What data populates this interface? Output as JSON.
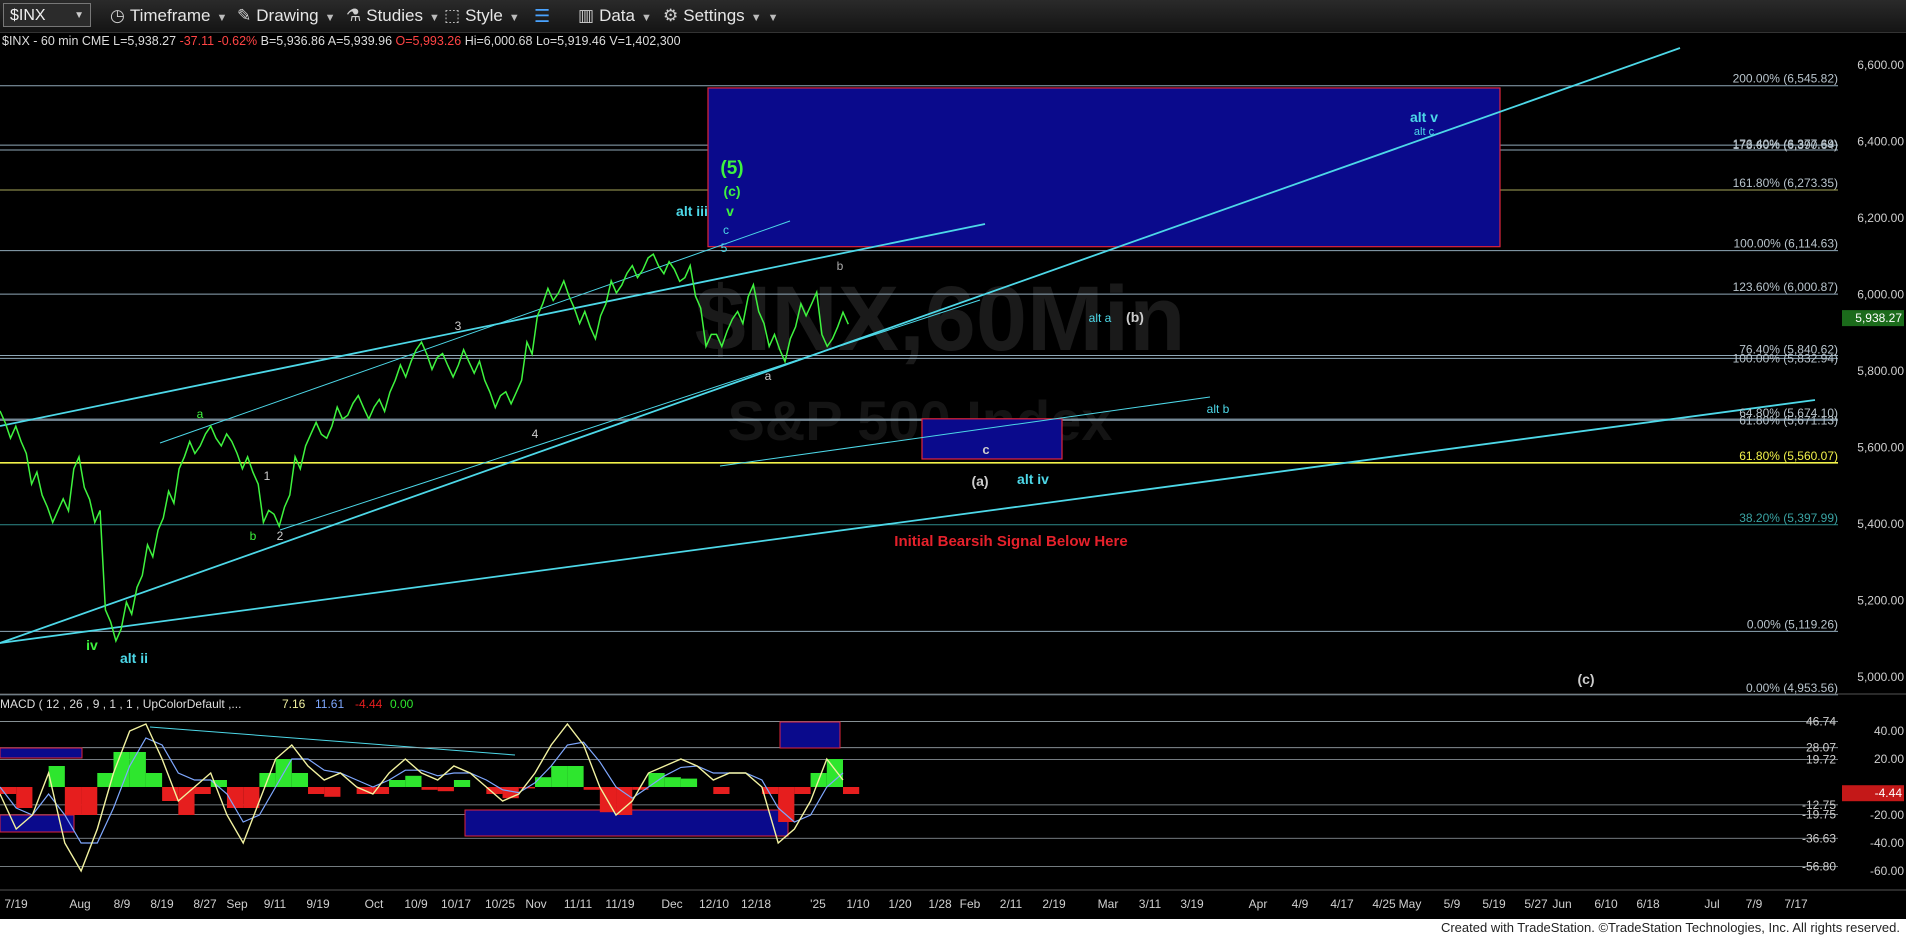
{
  "toolbar": {
    "symbol": "$INX",
    "timeframe": "Timeframe",
    "drawing": "Drawing",
    "studies": "Studies",
    "style": "Style",
    "data": "Data",
    "settings": "Settings"
  },
  "infobar": {
    "symbol": "$INX - 60 min  CME",
    "last": "L=5,938.27",
    "change": "-37.11",
    "pct": "-0.62%",
    "bid": "B=5,936.86",
    "ask": "A=5,939.96",
    "open": "O=5,993.26",
    "high": "Hi=6,000.68",
    "low": "Lo=5,919.46",
    "volume": "V=1,402,300"
  },
  "watermark": {
    "line1": "$INX,60Min",
    "line2": "S&P 500 Index"
  },
  "colors": {
    "price": "#3ef33e",
    "trend": "#4dd8e8",
    "box": "#0a0a8c",
    "box_border": "#e0243c",
    "fib_line": "#8fa8b8",
    "fib_yellow": "#f2f24a",
    "bearish": "#e5212b",
    "macd_line": "#f2f2a0",
    "signal_line": "#7fa8ff",
    "hist_pos": "#2ee62e",
    "hist_neg": "#e61e1e"
  },
  "chart_data": [
    {
      "type": "line",
      "title": "$INX - 60 min",
      "ylim": [
        4950,
        6700
      ],
      "y_ticks": [
        "6,600.00",
        "6,400.00",
        "6,200.00",
        "6,000.00",
        "5,800.00",
        "5,600.00",
        "5,400.00",
        "5,200.00",
        "5,000.00"
      ],
      "y_tick_values": [
        6600,
        6400,
        6200,
        6000,
        5800,
        5600,
        5400,
        5200,
        5000
      ],
      "x_ticks": [
        "7/19",
        "Aug",
        "8/9",
        "8/19",
        "8/27",
        "Sep",
        "9/11",
        "9/19",
        "Oct",
        "10/9",
        "10/17",
        "10/25",
        "Nov",
        "11/11",
        "11/19",
        "Dec",
        "12/10",
        "12/18",
        "'25",
        "1/10",
        "1/20",
        "1/28",
        "Feb",
        "2/11",
        "2/19",
        "Mar",
        "3/11",
        "3/19",
        "Apr",
        "4/9",
        "4/17",
        "4/25",
        "May",
        "5/9",
        "5/19",
        "5/27",
        "Jun",
        "6/10",
        "6/18",
        "Jul",
        "7/9",
        "7/17"
      ],
      "last_price": "5,938.27",
      "series": [
        {
          "values": [
            5680,
            5640,
            5600,
            5520,
            5460,
            5420,
            5450,
            5560,
            5480,
            5420,
            5160,
            5110,
            5180,
            5250,
            5330,
            5400,
            5470,
            5560,
            5600,
            5620,
            5640,
            5620,
            5600,
            5560,
            5520,
            5420,
            5410,
            5460,
            5560,
            5620,
            5650,
            5640,
            5690,
            5700,
            5720,
            5690,
            5710,
            5760,
            5800,
            5840,
            5860,
            5820,
            5830,
            5800,
            5840,
            5810,
            5760,
            5720,
            5730,
            5760,
            5860,
            5960,
            6000,
            6020,
            5980,
            5940,
            5900,
            5960,
            6020,
            6040,
            6060,
            6080,
            6090,
            6070,
            6050,
            6060,
            5980,
            5880,
            5880,
            5920,
            5940,
            6010,
            5940,
            5880,
            5840,
            5900,
            5960,
            5990,
            5880,
            5900,
            5938
          ]
        }
      ],
      "fib_levels": [
        {
          "label": "200.00% (6,545.82)",
          "value": 6545.82
        },
        {
          "label": "176.40% (6,377.69)",
          "value": 6377.69
        },
        {
          "label": "173.60% (6,390.64)",
          "value": 6390.64
        },
        {
          "label": "161.80% (6,273.35)",
          "value": 6273.35
        },
        {
          "label": "100.00% (6,114.63)",
          "value": 6114.63
        },
        {
          "label": "123.60% (6,000.87)",
          "value": 6000.87
        },
        {
          "label": "76.40% (5,840.62)",
          "value": 5840.62
        },
        {
          "label": "100.00% (5,832.94)",
          "value": 5832.94
        },
        {
          "label": "64.80% (5,674.10)",
          "value": 5674.1
        },
        {
          "label": "61.80% (5,671.13)",
          "value": 5671.13
        },
        {
          "label": "61.80% (5,560.07)",
          "value": 5560.07
        },
        {
          "label": "38.20% (5,397.99)",
          "value": 5397.99
        },
        {
          "label": "0.00% (5,119.26)",
          "value": 5119.26
        },
        {
          "label": "0.00% (4,953.56)",
          "value": 4953.56
        }
      ],
      "zones": [
        {
          "name": "upper-target",
          "top": 6540,
          "bottom": 6125
        },
        {
          "name": "lower-target",
          "top": 5675,
          "bottom": 5570
        }
      ],
      "annotations": [
        "(5)",
        "(c)",
        "v",
        "c",
        "5",
        "alt iii",
        "b",
        "3",
        "a",
        "4",
        "1",
        "2",
        "b",
        "iv",
        "alt ii",
        "a",
        "alt a",
        "(b)",
        "alt b",
        "c",
        "(a)",
        "alt iv",
        "alt v",
        "alt c",
        "(c)",
        "Initial Bearsih Signal Below Here"
      ]
    },
    {
      "type": "line",
      "title": "MACD ( 12 , 26 , 9 , 1 , 1 , UpColorDefault ,...",
      "legend_values": [
        "7.16",
        "11.61",
        "-4.44",
        "0.00"
      ],
      "ylim": [
        -65,
        50
      ],
      "y_ticks": [
        "40.00",
        "20.00",
        "-20.00",
        "-40.00",
        "-60.00"
      ],
      "y_tick_values": [
        40,
        20,
        -20,
        -40,
        -60
      ],
      "level_labels": [
        "46.74",
        "28.07",
        "19.72",
        "-12.75",
        "-19.75",
        "-36.63",
        "-56.80"
      ],
      "level_values": [
        46.74,
        28.07,
        19.72,
        -12.75,
        -19.75,
        -36.63,
        -56.8
      ],
      "current_value": "-4.44",
      "series": [
        {
          "name": "MACD",
          "values": [
            -5,
            -30,
            -20,
            10,
            -40,
            -60,
            -30,
            10,
            40,
            45,
            20,
            -10,
            0,
            10,
            -20,
            -40,
            -10,
            20,
            30,
            15,
            5,
            10,
            0,
            -5,
            10,
            20,
            10,
            5,
            15,
            10,
            0,
            -10,
            -5,
            10,
            30,
            45,
            30,
            0,
            -20,
            -10,
            10,
            15,
            20,
            15,
            5,
            10,
            10,
            0,
            -40,
            -30,
            -10,
            20,
            5
          ]
        },
        {
          "name": "Signal",
          "values": [
            0,
            -15,
            -20,
            -5,
            -20,
            -40,
            -40,
            -15,
            15,
            35,
            30,
            10,
            5,
            5,
            -5,
            -25,
            -20,
            0,
            20,
            20,
            12,
            10,
            5,
            0,
            5,
            12,
            12,
            8,
            10,
            10,
            5,
            -2,
            -4,
            3,
            15,
            30,
            32,
            18,
            0,
            -8,
            0,
            8,
            14,
            15,
            10,
            10,
            10,
            5,
            -15,
            -25,
            -20,
            0,
            10
          ]
        },
        {
          "name": "Histogram",
          "values": [
            -5,
            -15,
            0,
            15,
            -20,
            -20,
            10,
            25,
            25,
            10,
            -10,
            -20,
            -5,
            5,
            -15,
            -15,
            10,
            20,
            10,
            -5,
            -7,
            0,
            -5,
            -5,
            5,
            8,
            -2,
            -3,
            5,
            0,
            -5,
            -8,
            -1,
            7,
            15,
            15,
            -2,
            -18,
            -20,
            -2,
            10,
            7,
            6,
            0,
            -5,
            0,
            0,
            -5,
            -25,
            -5,
            10,
            20,
            -5
          ]
        }
      ]
    }
  ],
  "footer": "Created with TradeStation. ©TradeStation Technologies, Inc. All rights reserved."
}
